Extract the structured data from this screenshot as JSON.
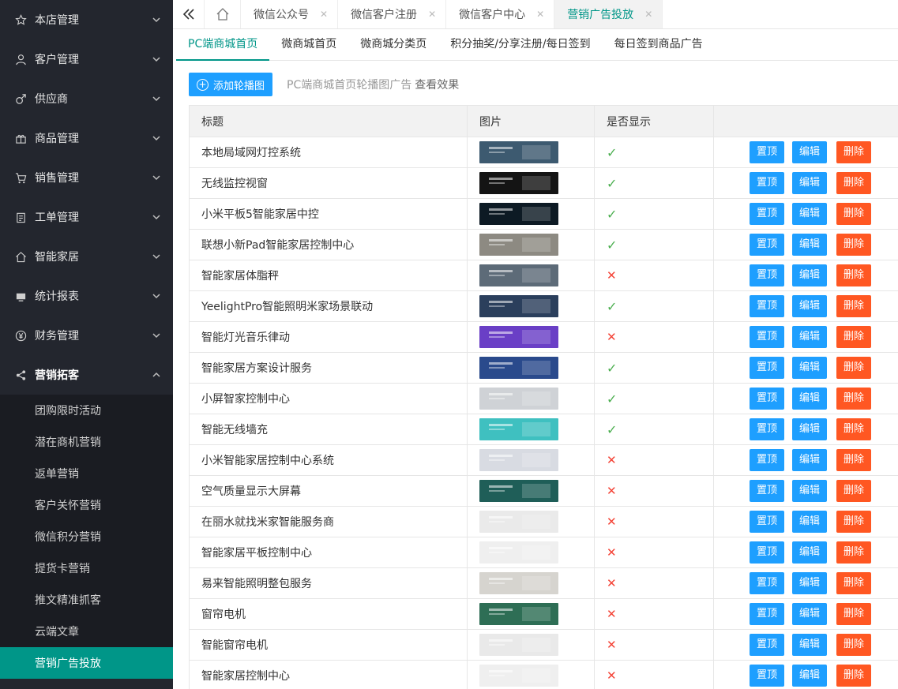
{
  "sidebar": {
    "items": [
      {
        "label": "本店管理",
        "icon": "star-icon"
      },
      {
        "label": "客户管理",
        "icon": "user-icon"
      },
      {
        "label": "供应商",
        "icon": "male-icon"
      },
      {
        "label": "商品管理",
        "icon": "gift-icon"
      },
      {
        "label": "销售管理",
        "icon": "cart-icon"
      },
      {
        "label": "工单管理",
        "icon": "clipboard-icon"
      },
      {
        "label": "智能家居",
        "icon": "home-icon"
      },
      {
        "label": "统计报表",
        "icon": "monitor-icon"
      },
      {
        "label": "财务管理",
        "icon": "yen-icon"
      },
      {
        "label": "营销拓客",
        "icon": "share-icon"
      }
    ],
    "submenu": [
      "团购限时活动",
      "潜在商机营销",
      "返单营销",
      "客户关怀营销",
      "微信积分营销",
      "提货卡营销",
      "推文精准抓客",
      "云端文章",
      "营销广告投放"
    ]
  },
  "topbar": {
    "tabs": [
      "微信公众号",
      "微信客户注册",
      "微信客户中心",
      "营销广告投放"
    ],
    "close_glyph": "✕"
  },
  "subtabs": [
    "PC端商城首页",
    "微商城首页",
    "微商城分类页",
    "积分抽奖/分享注册/每日签到",
    "每日签到商品广告"
  ],
  "toolbar": {
    "add_label": "添加轮播图",
    "plus": "+",
    "note": "PC端商城首页轮播图广告",
    "link": "查看效果"
  },
  "table": {
    "headers": [
      "标题",
      "图片",
      "是否显示",
      ""
    ],
    "buttons": {
      "top": "置顶",
      "edit": "编辑",
      "del": "删除"
    },
    "marks": {
      "yes": "✓",
      "no": "✕"
    },
    "rows": [
      {
        "title": "本地局域网灯控系统",
        "shown": true,
        "color": "#3d5a70"
      },
      {
        "title": "无线监控视窗",
        "shown": true,
        "color": "#141414"
      },
      {
        "title": "小米平板5智能家居中控",
        "shown": true,
        "color": "#0d1a24"
      },
      {
        "title": "联想小新Pad智能家居控制中心",
        "shown": true,
        "color": "#8d8a82"
      },
      {
        "title": "智能家居体脂秤",
        "shown": false,
        "color": "#5d6b78"
      },
      {
        "title": "YeelightPro智能照明米家场景联动",
        "shown": true,
        "color": "#2b3f5c"
      },
      {
        "title": "智能灯光音乐律动",
        "shown": false,
        "color": "#6a3fc6"
      },
      {
        "title": "智能家居方案设计服务",
        "shown": true,
        "color": "#2a4a8c"
      },
      {
        "title": "小屏智家控制中心",
        "shown": true,
        "color": "#cfd2d6"
      },
      {
        "title": "智能无线墙充",
        "shown": true,
        "color": "#3fc0c0"
      },
      {
        "title": "小米智能家居控制中心系统",
        "shown": false,
        "color": "#d8dbe2"
      },
      {
        "title": "空气质量显示大屏幕",
        "shown": false,
        "color": "#1f5e58"
      },
      {
        "title": "在丽水就找米家智能服务商",
        "shown": false,
        "color": "#eaeaea"
      },
      {
        "title": "智能家居平板控制中心",
        "shown": false,
        "color": "#efefef"
      },
      {
        "title": "易来智能照明整包服务",
        "shown": false,
        "color": "#d6d4cf"
      },
      {
        "title": "窗帘电机",
        "shown": false,
        "color": "#2e6e55"
      },
      {
        "title": "智能窗帘电机",
        "shown": false,
        "color": "#e9e9e9"
      },
      {
        "title": "智能家居控制中心",
        "shown": false,
        "color": "#efefef"
      }
    ]
  },
  "colors": {
    "accent": "#009688",
    "blue": "#1e9fff",
    "orange": "#ff5722"
  }
}
